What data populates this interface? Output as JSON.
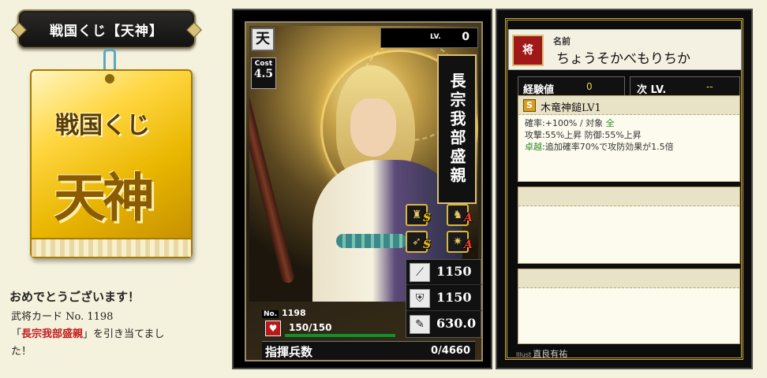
{
  "banner": {
    "title": "戦国くじ【天神】"
  },
  "ticket": {
    "line1": "戦国くじ",
    "line2": "天神"
  },
  "message": {
    "congrats": "おめでとうございます！",
    "line1": "武将カード No. 1198",
    "line2_open": "「",
    "line2_name": "長宗我部盛親",
    "line2_rest": "」を引き当てまし",
    "line3": "た！"
  },
  "card": {
    "rarity": "天",
    "cost_label": "Cost",
    "cost": "4.5",
    "level_label": "LV.",
    "level": "0",
    "name": "長宗我部盛親",
    "skills": [
      {
        "icon": "spear-unit-icon",
        "glyph": "♜",
        "rank": "S"
      },
      {
        "icon": "cavalry-unit-icon",
        "glyph": "♞",
        "rank": "A"
      },
      {
        "icon": "bow-unit-icon",
        "glyph": "➶",
        "rank": "S"
      },
      {
        "icon": "siege-unit-icon",
        "glyph": "✷",
        "rank": "A"
      }
    ],
    "stats": [
      {
        "icon": "attack-icon",
        "glyph": "⟋",
        "value": "1150"
      },
      {
        "icon": "defense-icon",
        "glyph": "⛨",
        "value": "1150"
      },
      {
        "icon": "intelligence-icon",
        "glyph": "✎",
        "value": "630.0"
      }
    ],
    "number_label": "No.",
    "number": "1198",
    "hp": "150/150",
    "hp_fraction": 1.0,
    "command_label": "指揮兵数",
    "command_value": "0/4660"
  },
  "info": {
    "general_badge": "将",
    "name_label": "名前",
    "name_reading": "ちょうそかべもりちか",
    "exp_label": "経験値",
    "exp_value": "0",
    "next_label": "次 LV.",
    "next_value": "--",
    "skill": {
      "rank": "S",
      "name": "木竜神鎚LV1",
      "line1_a": "確率:+100%  /  対象  ",
      "line1_target": "全",
      "line2": "攻撃:55%上昇 防御:55%上昇",
      "line3_label": "卓越",
      "line3_rest": ":追加確率70%で攻防効果が1.5倍"
    },
    "illust_label": "Illust",
    "illustrator": "直良有祐"
  }
}
